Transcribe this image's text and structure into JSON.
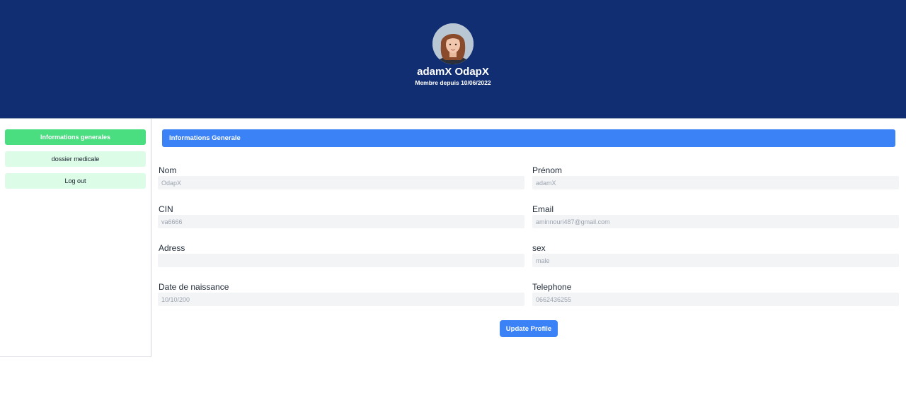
{
  "profile": {
    "name": "adamX OdapX",
    "member_since": "Membre depuis 10/06/2022",
    "avatar_icon": "user-photo"
  },
  "sidebar": {
    "items": [
      {
        "label": "Informations generales",
        "active": true
      },
      {
        "label": "dossier medicale",
        "active": false
      },
      {
        "label": "Log out",
        "active": false
      }
    ]
  },
  "main": {
    "section_title": "Informations Generale",
    "fields": {
      "nom": {
        "label": "Nom",
        "value": "OdapX"
      },
      "prenom": {
        "label": "Prénom",
        "value": "adamX"
      },
      "cin": {
        "label": "CIN",
        "value": "va6666"
      },
      "email": {
        "label": "Email",
        "value": "aminnouri487@gmail.com"
      },
      "adress": {
        "label": "Adress",
        "value": ""
      },
      "sex": {
        "label": "sex",
        "value": "male"
      },
      "date_naissance": {
        "label": "Date de naissance",
        "value": "10/10/200"
      },
      "telephone": {
        "label": "Telephone",
        "value": "0662436255"
      }
    },
    "update_button": "Update Profile"
  },
  "colors": {
    "header_bg": "#122e73",
    "primary": "#3b82f6",
    "sidebar_active": "#4ade80",
    "sidebar_item": "#dcfce7",
    "input_bg": "#f3f4f6"
  }
}
